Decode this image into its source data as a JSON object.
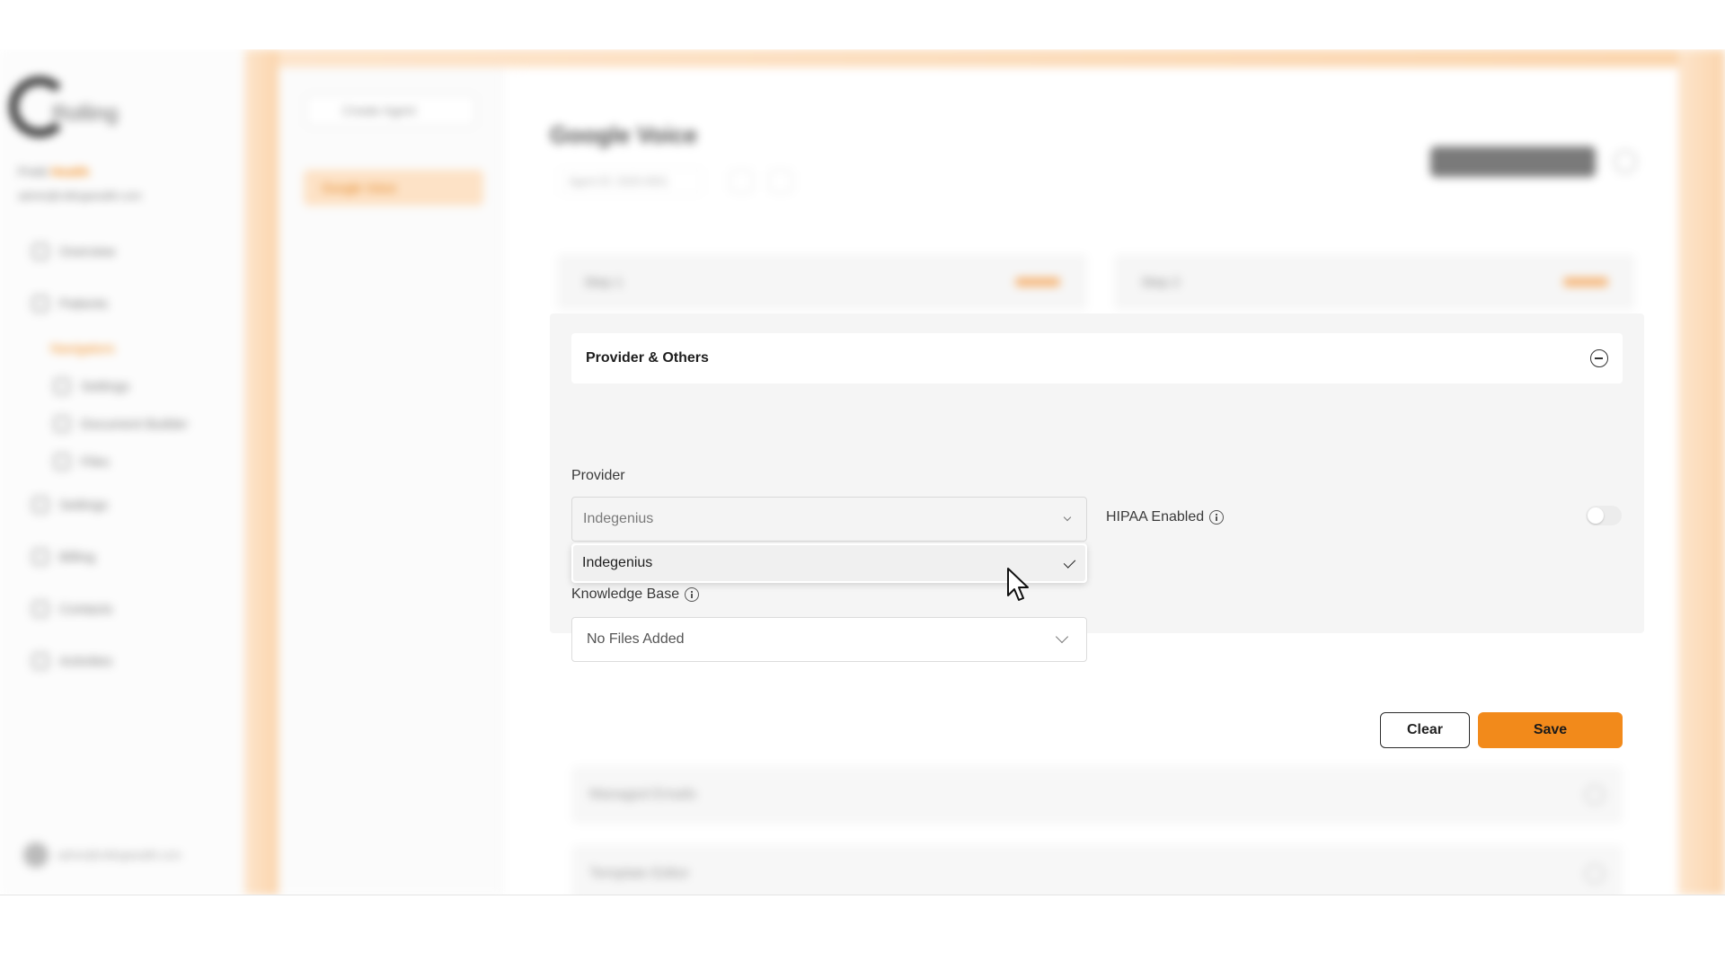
{
  "background_app": {
    "logo_text": "Rolling",
    "user_name": "Pretti",
    "user_accent": "Health",
    "user_email": "admin@rollingwealth.com",
    "nav_items": [
      "Overview",
      "Patients",
      "Navigators",
      "Settings",
      "Document Builder",
      "Files",
      "Settings",
      "Billing",
      "Contacts",
      "Activities"
    ],
    "subpanel_select": "Create Agent",
    "subpanel_item": "Google Voice",
    "page_title": "Google Voice",
    "page_subtitle": "Agent ID: 2025-0001",
    "tab_1": "Step 1",
    "tab_2": "Step 2",
    "bottom_section_1": "Managed Emails",
    "bottom_section_2": "Template Editor"
  },
  "section": {
    "title": "Provider & Others"
  },
  "provider": {
    "label": "Provider",
    "selected": "Indegenius",
    "options": [
      "Indegenius"
    ]
  },
  "hipaa": {
    "label": "HIPAA Enabled",
    "enabled": false
  },
  "knowledge_base": {
    "label": "Knowledge Base",
    "value": "No Files Added"
  },
  "actions": {
    "clear_label": "Clear",
    "save_label": "Save"
  },
  "colors": {
    "accent": "#f28a1b",
    "panel": "#f5f5f5"
  }
}
